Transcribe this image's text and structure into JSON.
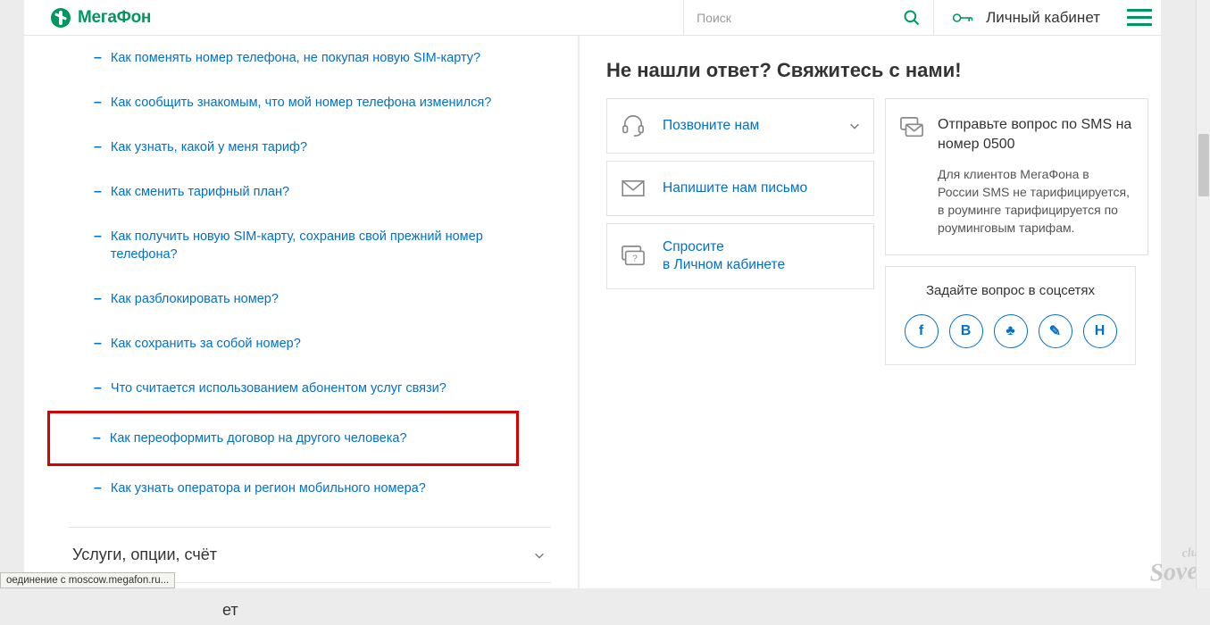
{
  "header": {
    "logo_text": "МегаФон",
    "search_placeholder": "Поиск",
    "account_label": "Личный кабинет"
  },
  "faq": {
    "items": [
      {
        "text": "Как поменять номер телефона, не покупая новую SIM-карту?"
      },
      {
        "text": "Как сообщить знакомым, что мой номер телефона изменился?"
      },
      {
        "text": "Как узнать, какой у меня тариф?"
      },
      {
        "text": "Как сменить тарифный план?"
      },
      {
        "text": "Как получить новую SIM-карту, сохранив свой прежний номер телефона?"
      },
      {
        "text": "Как разблокировать номер?"
      },
      {
        "text": "Как сохранить за собой номер?"
      },
      {
        "text": "Что считается использованием абонентом услуг связи?"
      },
      {
        "text": "Как переоформить договор на другого человека?"
      },
      {
        "text": "Как узнать оператора и регион мобильного номера?"
      }
    ],
    "highlighted_index": 8
  },
  "accordions": [
    {
      "title": "Услуги, опции, счёт"
    },
    {
      "title": "ет",
      "partial": true
    }
  ],
  "contact": {
    "heading": "Не нашли ответ? Свяжитесь с нами!",
    "call": "Позвоните нам",
    "write": "Напишите нам письмо",
    "ask_line1": "Спросите",
    "ask_line2": "в Личном кабинете",
    "sms_title": "Отправьте вопрос по SMS на номер 0500",
    "sms_body": "Для клиентов МегаФона в России SMS не тарифицируется, в роуминге тарифицируется по роуминговым тарифам.",
    "social_title": "Задайте вопрос в соцсетях",
    "social": [
      "f",
      "В",
      "♣",
      "✎",
      "Н"
    ]
  },
  "watermark": {
    "top": "club",
    "bottom": "Sovet"
  },
  "status_text": "оединение с moscow.megafon.ru..."
}
